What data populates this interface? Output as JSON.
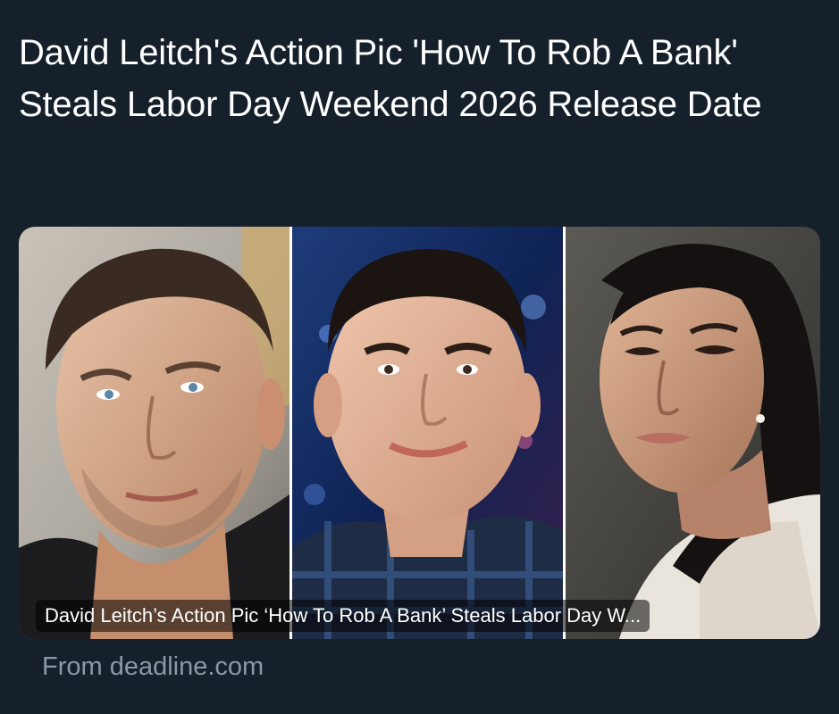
{
  "post": {
    "text": "David Leitch's Action Pic 'How To Rob A Bank' Steals Labor Day Weekend 2026 Release Date"
  },
  "card": {
    "image_caption": "David Leitch’s Action Pic ‘How To Rob A Bank’ Steals Labor Day W...",
    "source": "From deadline.com",
    "photos": [
      {
        "subject": "man with short dark hair and stubble, light background"
      },
      {
        "subject": "man in plaid shirt smiling, blue studio background"
      },
      {
        "subject": "woman with dark hair looking over shoulder, grey background"
      }
    ]
  },
  "colors": {
    "background": "#15202b",
    "text": "#ffffff",
    "muted": "#8b98a5"
  }
}
